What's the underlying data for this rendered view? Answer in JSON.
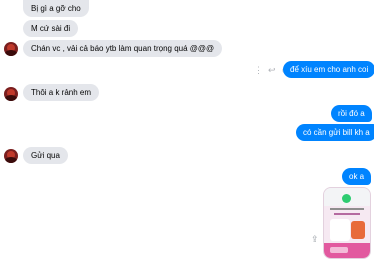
{
  "messages": [
    {
      "text": "Bị gì a gỡ cho"
    },
    {
      "text": "M cứ sài đi"
    },
    {
      "text": "Chán vc , vải cả báo ytb làm quan trọng quá @@@"
    },
    {
      "text": "để xíu em cho anh coi"
    },
    {
      "text": "Thôi a k rảnh em"
    },
    {
      "text": "rồi đó a"
    },
    {
      "text": "có cần gửi bill kh a"
    },
    {
      "text": "Gửi qua"
    },
    {
      "text": "ok a"
    }
  ],
  "icons": {
    "more": "more-options-icon",
    "reply": "reply-icon",
    "react": "react-emoji-icon",
    "share": "share-icon"
  },
  "colors": {
    "outgoing_bubble": "#0084ff",
    "incoming_bubble": "#e4e6eb",
    "seen_indicator": "#0084ff"
  }
}
